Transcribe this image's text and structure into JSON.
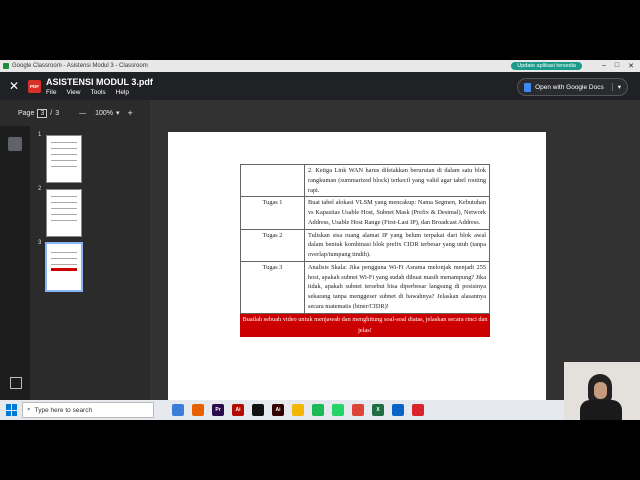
{
  "browser": {
    "tab_title": "Google Classroom - Asistensi Modul 3 - Classroom",
    "update_button": "Update aplikasi tersedia",
    "minimize": "–",
    "maximize": "□",
    "close": "✕"
  },
  "viewer": {
    "close_icon": "✕",
    "badge": "PDF",
    "title": "ASISTENSI MODUL 3.pdf",
    "menu": [
      "File",
      "View",
      "Tools",
      "Help"
    ],
    "open_with": "Open with Google Docs",
    "page_label": "Page",
    "page_current": "3",
    "page_sep": "/",
    "page_total": "3",
    "zoom": "100%",
    "zoom_out": "—",
    "zoom_in": "+"
  },
  "thumbnails": [
    "1",
    "2",
    "3"
  ],
  "document": {
    "rows": [
      {
        "label": "",
        "text": "2. Ketiga Link WAN harus diletakkan berurutan di dalam satu blok rangkuman (summarized block) terkecil yang valid agar tabel routing rapi."
      },
      {
        "label": "Tugas 1",
        "text": "Buat tabel alokasi VLSM yang mencakup: Nama Segmen, Kebutuhan vs Kapasitas Usable Host, Subnet Mask (Prefix & Desimal), Network Address, Usable Host Range (First-Last IP), dan Broadcast Address."
      },
      {
        "label": "Tugas 2",
        "text": "Tuliskan sisa ruang alamat IP yang belum terpakai dari blok awal dalam bentuk kombinasi blok prefix CIDR terbesar yang utuh (tanpa overlap/tumpang tindih)."
      },
      {
        "label": "Tugas 3",
        "text": "Analisis Skala: Jika pengguna Wi-Fi Asrama melonjak menjadi 255 host, apakah subnet Wi-Fi yang sudah dibuat masih menampung? Jika tidak, apakah subnet tersebut bisa diperbesar langsung di posisinya sekarang tanpa menggeser subnet di bawahnya? Jelaskan alasannya secara matematis (biner/CIDR)!"
      }
    ],
    "footer": "Buatlah sebuah video untuk menjawab dan menghitung soal-soal diatas, jelaskan secara rinci dan jelas!"
  },
  "taskbar": {
    "search_placeholder": "Type here to search",
    "apps": [
      {
        "name": "files-icon",
        "color": "#3b7dd8",
        "glyph": ""
      },
      {
        "name": "firefox-icon",
        "color": "#e66000",
        "glyph": ""
      },
      {
        "name": "premiere-icon",
        "color": "#2a0a4a",
        "glyph": "Pr"
      },
      {
        "name": "acrobat-icon",
        "color": "#b30b00",
        "glyph": "Ai"
      },
      {
        "name": "capcut-icon",
        "color": "#111111",
        "glyph": ""
      },
      {
        "name": "illustrator-icon",
        "color": "#330000",
        "glyph": "Ai"
      },
      {
        "name": "explorer-icon",
        "color": "#f2b705",
        "glyph": ""
      },
      {
        "name": "spotify-icon",
        "color": "#1db954",
        "glyph": ""
      },
      {
        "name": "whatsapp-icon",
        "color": "#25d366",
        "glyph": ""
      },
      {
        "name": "chrome-icon",
        "color": "#db4437",
        "glyph": ""
      },
      {
        "name": "excel-icon",
        "color": "#1d6f42",
        "glyph": "X"
      },
      {
        "name": "outlook-icon",
        "color": "#0a64c8",
        "glyph": ""
      },
      {
        "name": "mail-icon",
        "color": "#d9232d",
        "glyph": ""
      }
    ]
  }
}
